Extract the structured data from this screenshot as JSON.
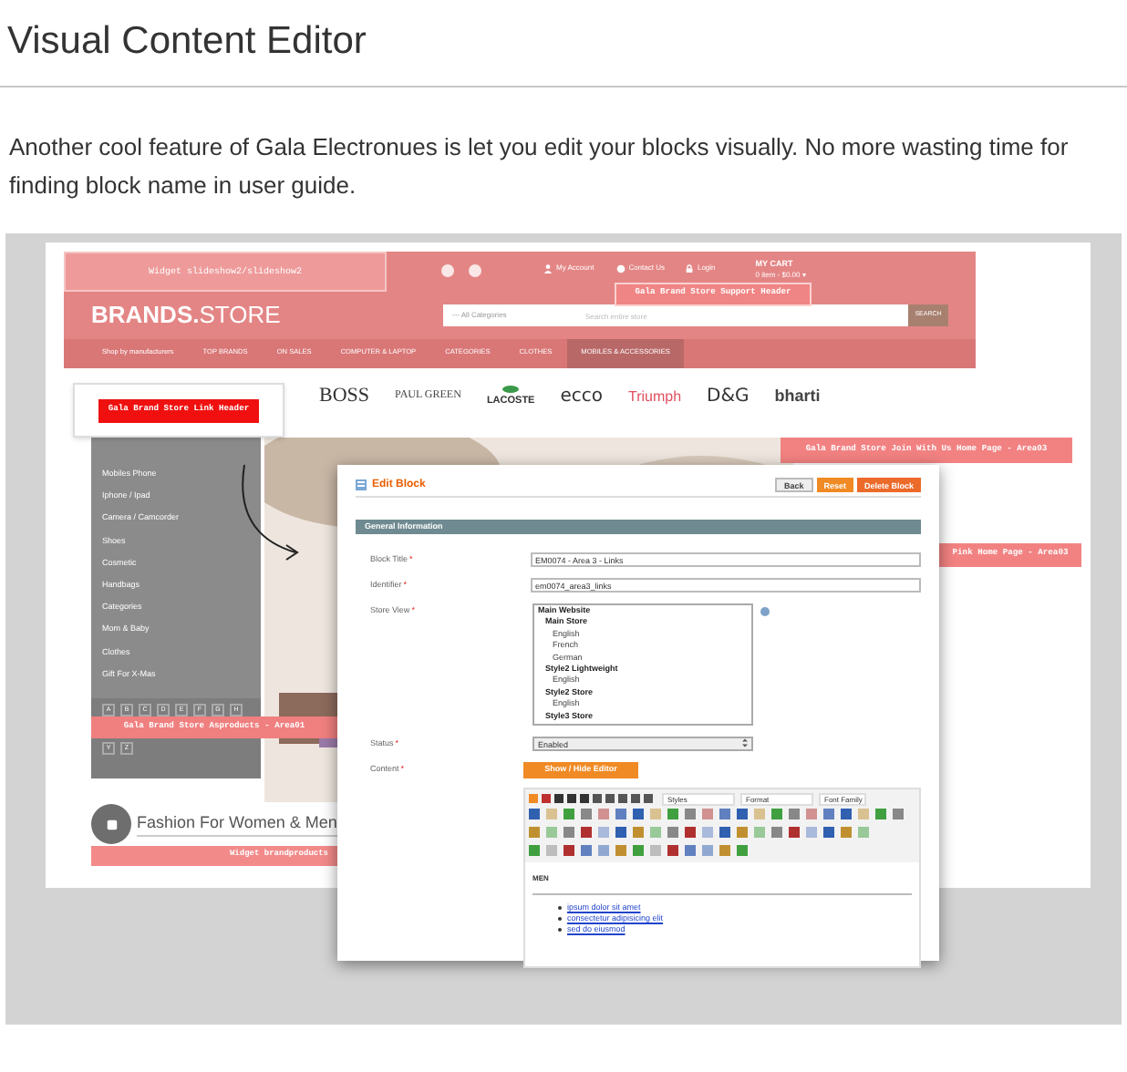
{
  "heading": "Visual Content Editor",
  "intro": "Another cool feature of Gala Electronues is let you edit your blocks visually. No more wasting time for finding block name in user guide.",
  "store": {
    "widget_label": "Widget slideshow2/slideshow2",
    "top_links": [
      "My Account",
      "Contact Us",
      "Login"
    ],
    "cart_title": "MY CART",
    "cart_summary": "0 item - $0.00 ▾",
    "logo_bold": "BRANDS.",
    "logo_light": "STORE",
    "category_select": "--- All Categories",
    "search_placeholder": "Search entire store",
    "search_button": "SEARCH",
    "nav": [
      {
        "label": "Shop by manufacturers",
        "selected": false
      },
      {
        "label": "TOP BRANDS",
        "selected": false
      },
      {
        "label": "ON SALES",
        "selected": false
      },
      {
        "label": "COMPUTER & LAPTOP",
        "selected": false
      },
      {
        "label": "CATEGORIES",
        "selected": false
      },
      {
        "label": "CLOTHES",
        "selected": false
      },
      {
        "label": "MOBILES & ACCESSORIES",
        "selected": true
      }
    ],
    "brands": [
      {
        "label": "BOSS",
        "kind": "serif"
      },
      {
        "label": "PAUL GREEN",
        "kind": "small-serif"
      },
      {
        "label": "LACOSTE",
        "kind": "croc"
      },
      {
        "label": "ecco",
        "kind": "round"
      },
      {
        "label": "Triumph",
        "kind": "red"
      },
      {
        "label": "D&G",
        "kind": "round"
      },
      {
        "label": "bharti",
        "kind": "bold"
      }
    ],
    "sidebar": [
      "Mobiles Phone",
      "Iphone / Ipad",
      "Camera / Camcorder",
      "Shoes",
      "Cosmetic",
      "Handbags",
      "Categories",
      "Mom & Baby",
      "Clothes",
      "Gift For X-Mas"
    ],
    "letters": [
      "A",
      "B",
      "C",
      "D",
      "E",
      "F",
      "G",
      "H"
    ],
    "letters_last": [
      "Y",
      "Z"
    ],
    "fashion_title": "Fashion For Women & Men",
    "widget_bottom": "Widget brandproducts"
  },
  "block_labels": [
    {
      "label": "Gala Brand Store Link Header",
      "kind": "boxed"
    },
    {
      "label": "Gala Brand Store Support Header",
      "kind": "support"
    },
    {
      "label": "Gala Brand Store Join With Us Home Page - Area03",
      "kind": "join"
    },
    {
      "label": "Pink Home Page - Area03",
      "kind": "pink"
    },
    {
      "label": "Gala Brand Store Asproducts - Area01",
      "kind": "asproducts"
    }
  ],
  "edit_block": {
    "title": "Edit Block",
    "buttons": [
      {
        "label": "Back",
        "kind": "plain"
      },
      {
        "label": "Reset",
        "kind": "orange"
      },
      {
        "label": "Delete Block",
        "kind": "delete"
      }
    ],
    "section": "General Information",
    "fields": [
      {
        "label": "Block Title",
        "mark": "*",
        "kind": "text",
        "value": "EM0074 - Area 3 - Links"
      },
      {
        "label": "Identifier",
        "mark": "*",
        "kind": "text",
        "value": "em0074_area3_links"
      },
      {
        "label": "Store View",
        "mark": "*",
        "kind": "multiselect",
        "options": [
          {
            "label": "Main Website",
            "kind": "group",
            "children": [
              {
                "label": "Main Store",
                "kind": "group",
                "children": [
                  {
                    "label": "English",
                    "kind": "option"
                  },
                  {
                    "label": "French",
                    "kind": "option"
                  },
                  {
                    "label": "German",
                    "kind": "option"
                  }
                ]
              },
              {
                "label": "Style2 Lightweight",
                "kind": "group",
                "children": [
                  {
                    "label": "English",
                    "kind": "option"
                  }
                ]
              },
              {
                "label": "Style2 Store",
                "kind": "group",
                "children": [
                  {
                    "label": "English",
                    "kind": "option"
                  }
                ]
              },
              {
                "label": "Style3 Store",
                "kind": "group"
              }
            ]
          }
        ]
      },
      {
        "label": "Status",
        "mark": "*",
        "kind": "select",
        "value": "Enabled"
      },
      {
        "label": "Content",
        "mark": "*",
        "kind": "editor"
      }
    ],
    "editor_toggle": "Show / Hide Editor",
    "dropdowns": [
      "Styles",
      "Format",
      "Font Family"
    ],
    "content_heading": "MEN",
    "content_links": [
      "ipsum dolor sit amet",
      "consectetur adipisicing elit",
      "sed do eiusmod"
    ]
  }
}
